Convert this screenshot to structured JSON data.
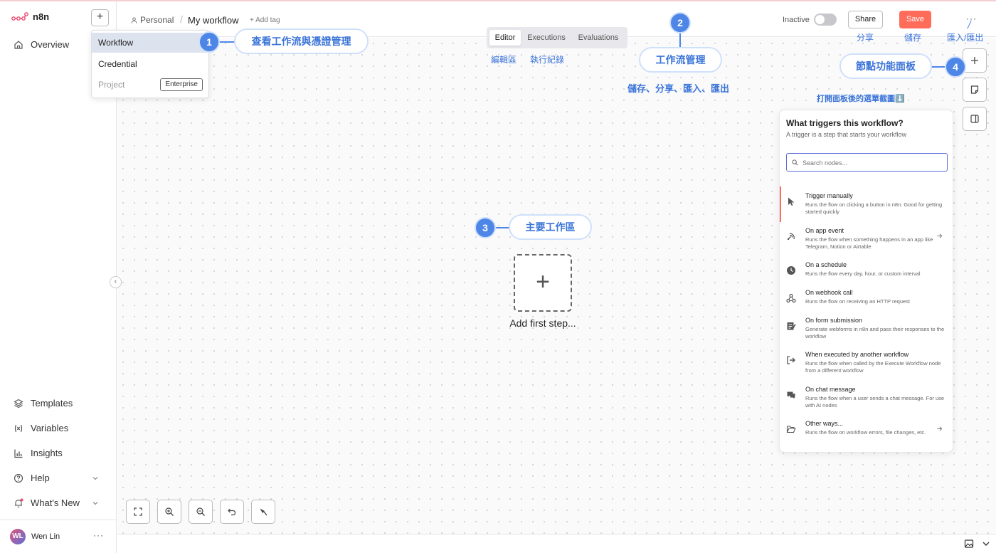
{
  "app": {
    "name": "n8n"
  },
  "sidebar": {
    "new_label": "+",
    "overview": "Overview",
    "templates": "Templates",
    "variables": "Variables",
    "insights": "Insights",
    "help": "Help",
    "whats_new": "What's New",
    "collapse": "‹",
    "user": {
      "initials": "WL",
      "name": "Wen Lin",
      "more": "···"
    }
  },
  "dropdown": {
    "workflow": "Workflow",
    "credential": "Credential",
    "project": "Project",
    "enterprise_badge": "Enterprise"
  },
  "header": {
    "breadcrumb_project": "Personal",
    "breadcrumb_sep": "/",
    "workflow_name": "My workflow",
    "add_tag": "+ Add tag",
    "tabs": [
      "Editor",
      "Executions",
      "Evaluations"
    ],
    "status": "Inactive",
    "share": "Share",
    "save": "Save",
    "more": "···"
  },
  "canvas": {
    "add_first_plus": "+",
    "add_first_label": "Add first step..."
  },
  "panel": {
    "title": "What triggers this workflow?",
    "subtitle": "A trigger is a step that starts your workflow",
    "search_placeholder": "Search nodes...",
    "nodes": [
      {
        "title": "Trigger manually",
        "desc": "Runs the flow on clicking a button in n8n. Good for getting started quickly"
      },
      {
        "title": "On app event",
        "desc": "Runs the flow when something happens in an app like Telegram, Notion or Airtable"
      },
      {
        "title": "On a schedule",
        "desc": "Runs the flow every day, hour, or custom interval"
      },
      {
        "title": "On webhook call",
        "desc": "Runs the flow on receiving an HTTP request"
      },
      {
        "title": "On form submission",
        "desc": "Generate webforms in n8n and pass their responses to the workflow"
      },
      {
        "title": "When executed by another workflow",
        "desc": "Runs the flow when called by the Execute Workflow node from a different workflow"
      },
      {
        "title": "On chat message",
        "desc": "Runs the flow when a user sends a chat message. For use with AI nodes"
      },
      {
        "title": "Other ways...",
        "desc": "Runs the flow on workflow errors, file changes, etc."
      }
    ]
  },
  "annotations": {
    "n1": "1",
    "n1_label": "查看工作流與憑證管理",
    "n2": "2",
    "n2_label": "工作流管理",
    "n2_sub": "儲存、分享、匯入、匯出",
    "n3": "3",
    "n3_label": "主要工作區",
    "n4": "4",
    "n4_label": "節點功能面板",
    "n4_sub": "打開面板後的選單截圖⬇️",
    "editor_zh": "編輯區",
    "executions_zh": "執行紀錄",
    "share_zh": "分享",
    "save_zh": "儲存",
    "import_export_zh": "匯入/匯出"
  },
  "colors": {
    "accent": "#ff6d5a",
    "annotation": "#4e86e8",
    "highlight": "#5b6cd9"
  }
}
